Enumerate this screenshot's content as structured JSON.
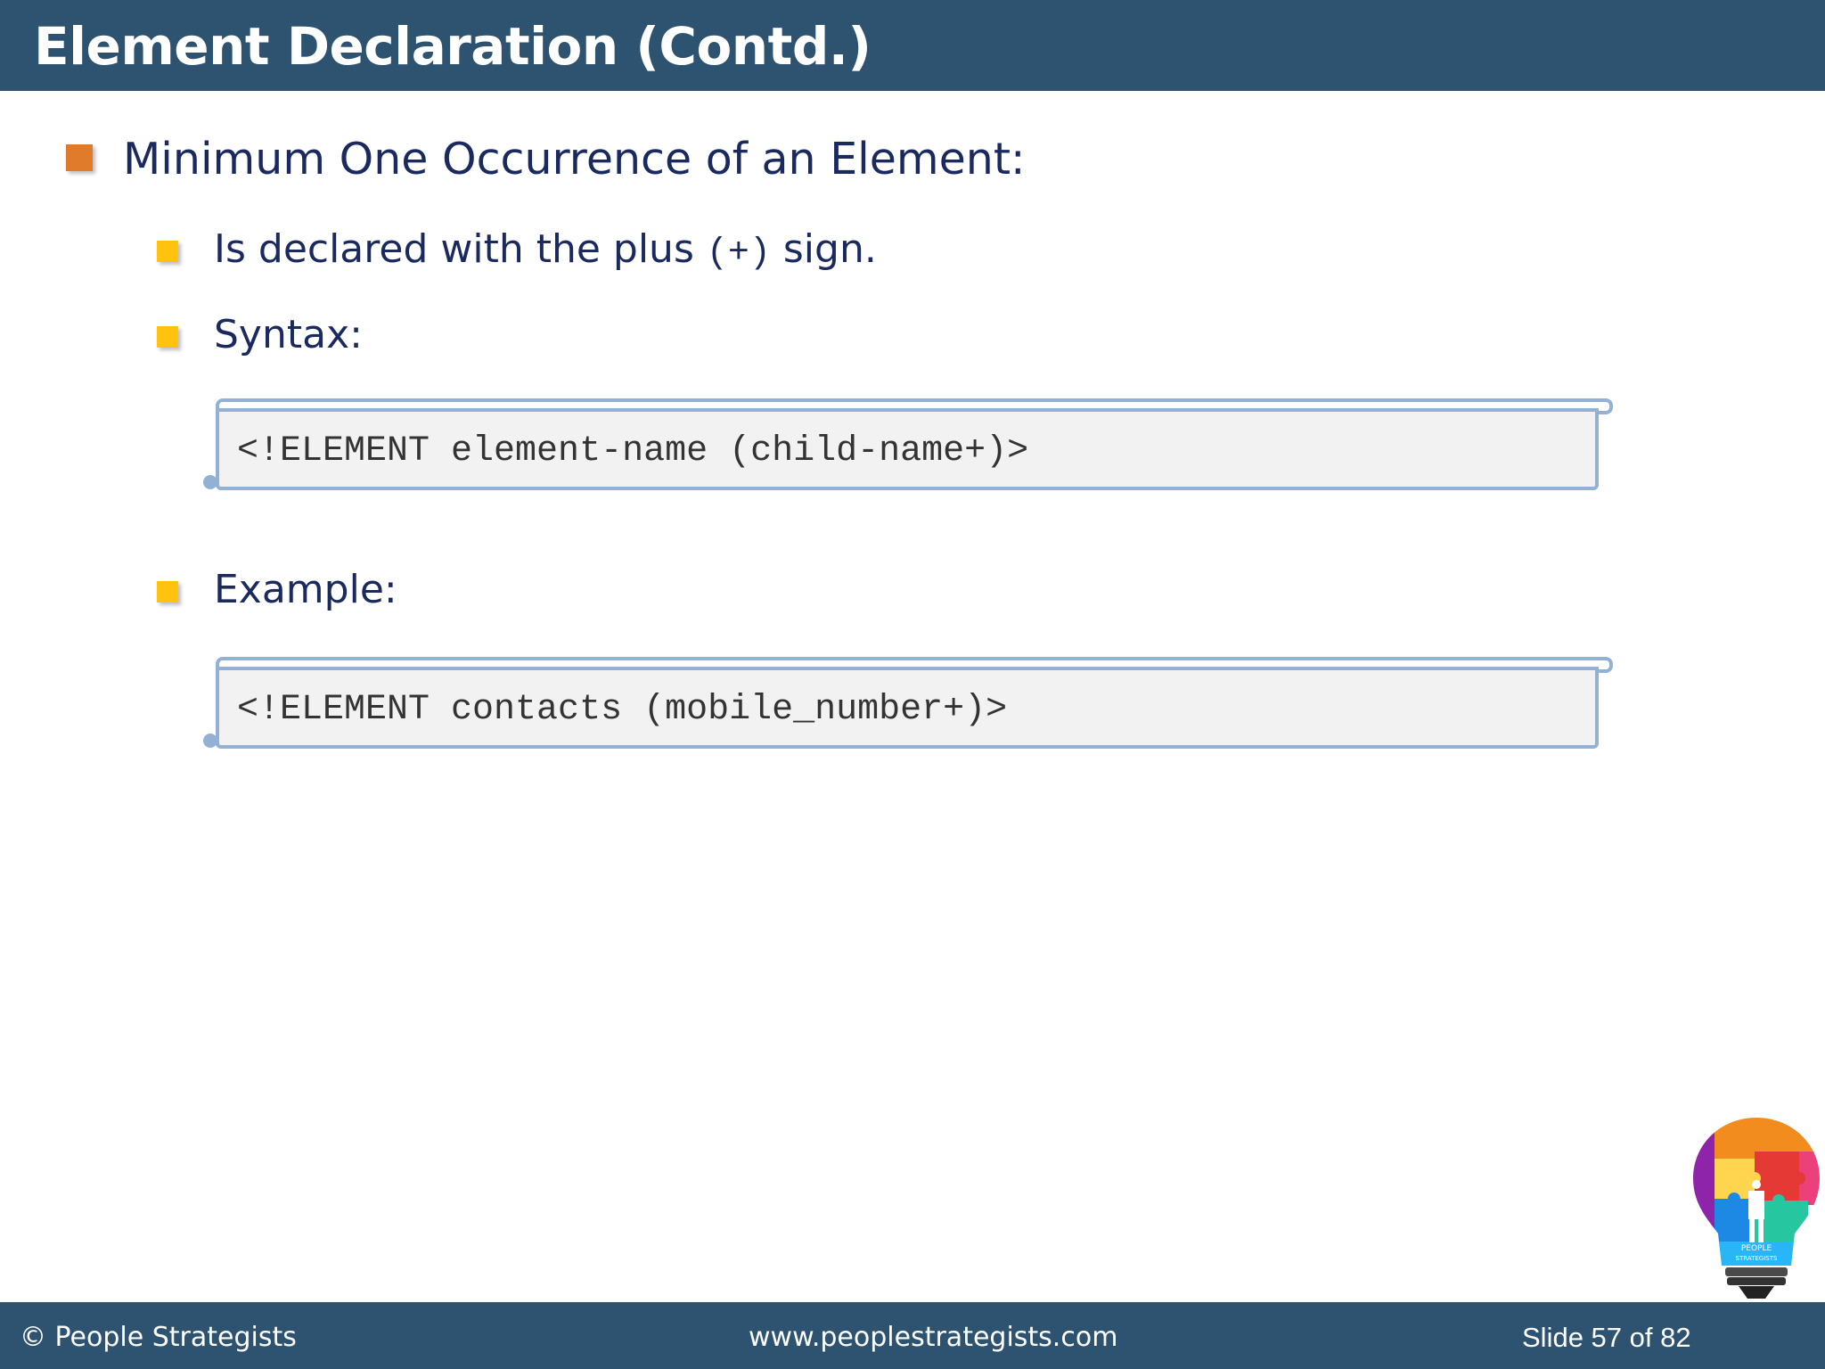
{
  "slide": {
    "title": "Element Declaration (Contd.)",
    "bullet1": "Minimum One Occurrence of an Element:",
    "sub1": {
      "before": "Is declared with the plus ",
      "code": "(+)",
      "after": " sign."
    },
    "sub2": "Syntax:",
    "syntax_code": "<!ELEMENT element-name (child-name+)>",
    "sub3": "Example:",
    "example_code": "<!ELEMENT contacts (mobile_number+)>"
  },
  "footer": {
    "copyright": "© People Strategists",
    "website": "www.peoplestrategists.com",
    "slide_number": "Slide 57 of 82"
  },
  "logo": {
    "icon": "lightbulb-puzzle-logo",
    "text_line1": "PEOPLE",
    "text_line2": "STRATEGISTS"
  },
  "colors": {
    "header_bg": "#2d5370",
    "text": "#1b2a5e",
    "bullet_l1": "#e07b2c",
    "bullet_l2": "#ffc20e",
    "code_border": "#93b1d4",
    "code_bg": "#f2f2f2"
  }
}
